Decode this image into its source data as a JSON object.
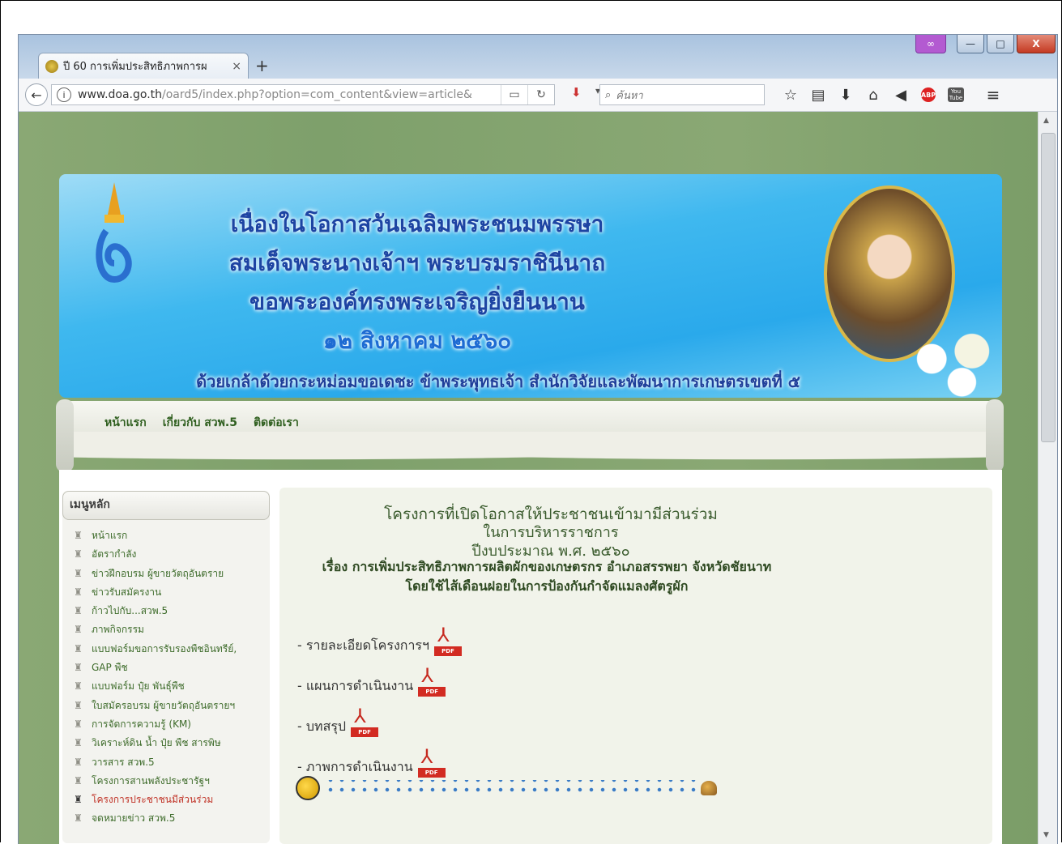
{
  "browser": {
    "tab_title": "ปี 60 การเพิ่มประสิทธิภาพการผ",
    "tab_close": "×",
    "new_tab": "+",
    "url_host": "www.doa.go.th",
    "url_path": "/oard5/index.php?option=com_content&view=article&",
    "search_placeholder": "ค้นหา",
    "window_buttons": {
      "minimize": "—",
      "maximize": "□",
      "close": "X"
    }
  },
  "banner": {
    "line1": "เนื่องในโอกาสวันเฉลิมพระชนมพรรษา",
    "line2": "สมเด็จพระนางเจ้าฯ พระบรมราชินีนาถ",
    "line3": "ขอพระองค์ทรงพระเจริญยิ่งยืนนาน",
    "line4": "๑๒ สิงหาคม ๒๕๖๐",
    "line5": "ด้วยเกล้าด้วยกระหม่อมขอเดชะ ข้าพระพุทธเจ้า สำนักวิจัยและพัฒนาการเกษตรเขตที่ ๕"
  },
  "topnav": [
    "หน้าแรก",
    "เกี่ยวกับ สวพ.5",
    "ติดต่อเรา"
  ],
  "sidebar": {
    "title": "เมนูหลัก",
    "items": [
      "หน้าแรก",
      "อัตรากำลัง",
      "ข่าวฝึกอบรม ผู้ขายวัตถุอันตราย",
      "ข่าวรับสมัครงาน",
      "ก้าวไปกับ...สวพ.5",
      "ภาพกิจกรรม",
      "แบบฟอร์มขอการรับรองพืชอินทรีย์,",
      "GAP พืช",
      "แบบฟอร์ม ปุ๋ย พันธุ์พืช",
      "ใบสมัครอบรม ผู้ขายวัตถุอันตรายฯ",
      "การจัดการความรู้ (KM)",
      "วิเคราะห์ดิน น้ำ ปุ๋ย พืช สารพิษ",
      "วารสาร สวพ.5",
      "โครงการสานพลังประชารัฐฯ",
      "โครงการประชาชนมีส่วนร่วม",
      "จดหมายข่าว สวพ.5"
    ],
    "active_index": 14
  },
  "main": {
    "title1": "โครงการที่เปิดโอกาสให้ประชาชนเข้ามามีส่วนร่วม",
    "title2": "ในการบริหารราชการ",
    "title3": "ปีงบประมาณ พ.ศ. ๒๕๖๐",
    "title4": "เรื่อง การเพิ่มประสิทธิภาพการผลิตผักของเกษตรกร อำเภอสรรพยา จังหวัดชัยนาท",
    "title5": "โดยใช้ไส้เดือนฝอยในการป้องกันกำจัดแมลงศัตรูผัก",
    "links": [
      "- รายละเอียดโครงการฯ",
      "- แผนการดำเนินงาน",
      "- บทสรุป",
      "- ภาพการดำเนินงาน"
    ],
    "pdf_label": "PDF"
  }
}
